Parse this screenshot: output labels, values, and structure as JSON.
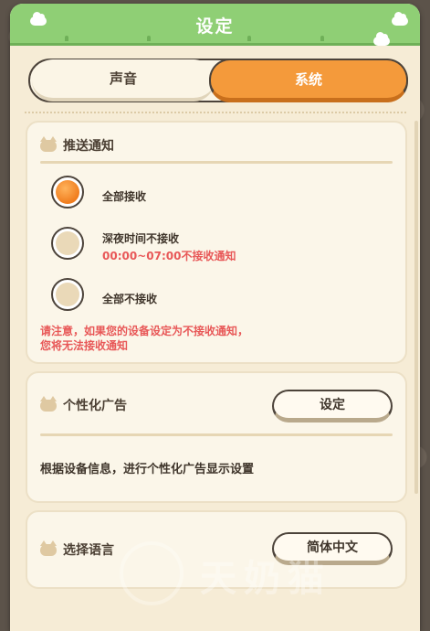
{
  "header": {
    "title": "设定"
  },
  "tabs": [
    {
      "label": "声音",
      "active": false
    },
    {
      "label": "系统",
      "active": true
    }
  ],
  "notification": {
    "title": "推送通知",
    "options": [
      {
        "label": "全部接收",
        "sub": "",
        "selected": true
      },
      {
        "label": "深夜时间不接收",
        "sub": "00:00~07:00不接收通知",
        "selected": false
      },
      {
        "label": "全部不接收",
        "sub": "",
        "selected": false
      }
    ],
    "note_line1": "请注意，如果您的设备设定为不接收通知，",
    "note_line2": "您将无法接收通知"
  },
  "ads": {
    "title": "个性化广告",
    "button_label": "设定",
    "description": "根据设备信息，进行个性化广告显示设置"
  },
  "language": {
    "title": "选择语言",
    "button_label": "简体中文"
  },
  "watermark": "天奶猫",
  "colors": {
    "header_green": "#8fcf75",
    "accent_orange": "#f49a3b",
    "warning_red": "#e85858",
    "panel_cream": "#f6ecd6"
  }
}
